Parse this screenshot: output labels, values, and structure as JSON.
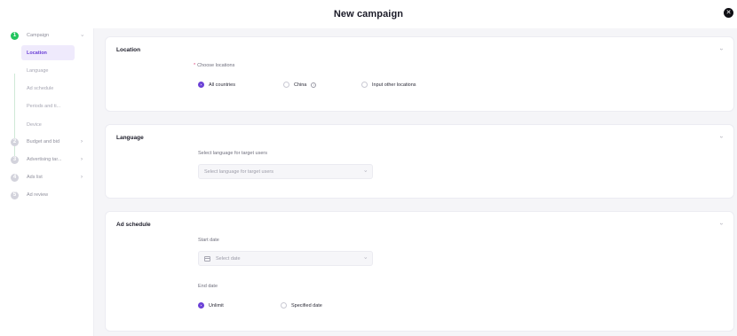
{
  "header": {
    "title": "New campaign",
    "close_icon": "close-icon"
  },
  "sidebar": {
    "steps": [
      {
        "num": "1",
        "label": "Campaign"
      },
      {
        "num": "2",
        "label": "Budget and bid"
      },
      {
        "num": "3",
        "label": "Advertising tar..."
      },
      {
        "num": "4",
        "label": "Ads list"
      },
      {
        "num": "5",
        "label": "Ad review"
      }
    ],
    "sub_items": [
      "Location",
      "Language",
      "Ad schedule",
      "Periods and ti...",
      "Device"
    ]
  },
  "location": {
    "title": "Location",
    "choose_label": "Choose locations",
    "options": [
      "All countries",
      "China",
      "Input other locations"
    ],
    "selected": "All countries"
  },
  "language": {
    "title": "Language",
    "label": "Select language for target users",
    "placeholder": "Select language for target users"
  },
  "schedule": {
    "title": "Ad schedule",
    "start_label": "Start date",
    "start_placeholder": "Select date",
    "end_label": "End date",
    "end_options": [
      "Unlimit",
      "Specified date"
    ],
    "end_selected": "Unlimit"
  },
  "colors": {
    "accent": "#6a3fd6",
    "step_active": "#22c55e",
    "background": "#f5f5f8"
  }
}
